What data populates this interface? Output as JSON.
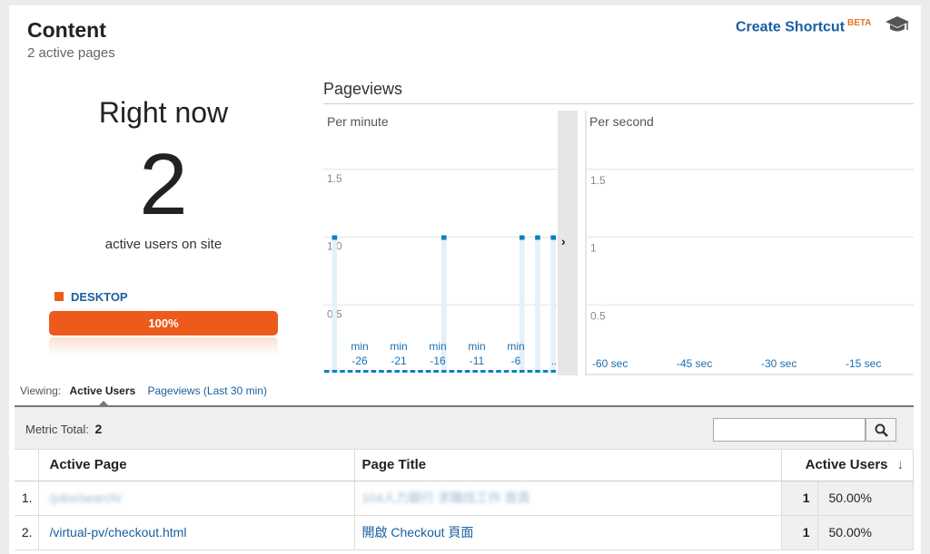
{
  "header": {
    "title": "Content",
    "subtitle": "2 active pages",
    "shortcut_label": "Create Shortcut",
    "beta_label": "BETA"
  },
  "right_now": {
    "title": "Right now",
    "count": "2",
    "label": "active users on site",
    "device_label": "DESKTOP",
    "device_percent_label": "100%",
    "device_percent": 100
  },
  "pageviews": {
    "title": "Pageviews",
    "per_minute_label": "Per minute",
    "per_second_label": "Per second"
  },
  "chart_data": [
    {
      "type": "bar",
      "title": "Per minute",
      "y_ticks": [
        "1.5",
        "1.0",
        "0.5"
      ],
      "ylim": [
        0,
        2
      ],
      "x_tick_labels": [
        {
          "top": "min",
          "bottom": "-26"
        },
        {
          "top": "min",
          "bottom": "-21"
        },
        {
          "top": "min",
          "bottom": "-16"
        },
        {
          "top": "min",
          "bottom": "-11"
        },
        {
          "top": "min",
          "bottom": "-6"
        }
      ],
      "x_trailing_label": "..",
      "x": [
        -30,
        -29,
        -28,
        -27,
        -26,
        -25,
        -24,
        -23,
        -22,
        -21,
        -20,
        -19,
        -18,
        -17,
        -16,
        -15,
        -14,
        -13,
        -12,
        -11,
        -10,
        -9,
        -8,
        -7,
        -6,
        -5,
        -4,
        -3,
        -2,
        -1
      ],
      "values": [
        0,
        1,
        0,
        0,
        0,
        0,
        0,
        0,
        0,
        0,
        0,
        0,
        0,
        0,
        0,
        1,
        0,
        0,
        0,
        0,
        0,
        0,
        0,
        0,
        0,
        1,
        0,
        1,
        0,
        1
      ]
    },
    {
      "type": "bar",
      "title": "Per second",
      "y_ticks": [
        "1.5",
        "1",
        "0.5"
      ],
      "ylim": [
        0,
        2
      ],
      "x_tick_labels": [
        "-60 sec",
        "-45 sec",
        "-30 sec",
        "-15 sec"
      ],
      "values": []
    }
  ],
  "viewing": {
    "label": "Viewing:",
    "active_option": "Active Users",
    "other_option": "Pageviews (Last 30 min)"
  },
  "table": {
    "metric_label": "Metric Total:",
    "metric_value": "2",
    "search_placeholder": "",
    "columns": [
      "Active Page",
      "Page Title",
      "Active Users"
    ],
    "rows": [
      {
        "num": "1.",
        "page": "/jobs/search/",
        "title": "104人力銀行 求職找工作 首頁",
        "users": "1",
        "pct": "50.00%"
      },
      {
        "num": "2.",
        "page": "/virtual-pv/checkout.html",
        "title": "開啟 Checkout 頁面",
        "users": "1",
        "pct": "50.00%"
      }
    ]
  },
  "colors": {
    "bar": "#0d7fc0",
    "bar_bg": "#e3f1f9",
    "accent": "#ec5a1c",
    "link": "#1a5fa0"
  }
}
